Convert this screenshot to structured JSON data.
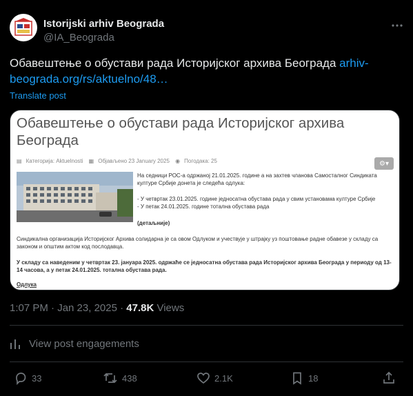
{
  "author": {
    "name": "Istorijski arhiv Beograda",
    "handle": "@IA_Beograda"
  },
  "post": {
    "text": "Обавештење о обустави рада Историјског архива Београда ",
    "link": "arhiv-beograda.org/rs/aktuelno/48…",
    "translate_label": "Translate post"
  },
  "card": {
    "title": "Обавештење о обустави рада Историјског архива Београда",
    "meta_category": "Категорија: Aktuelnosti",
    "meta_published": "Објављено 23 January 2025",
    "meta_views": "Погодака: 25",
    "p1": "На седници РОС-а одржаној 21.01.2025. године а на захтев чланова Самосталног Синдиката културе Србије донета је следећа одлука:",
    "p2a": "- У четвртак 23.01.2025. године једносатна обустава рада у свим установама културе Србије",
    "p2b": "- У петак 24.01.2025. године тотална обустава рада",
    "p3": "(детаљније)",
    "p4": "Синдикална организација Историјског Архива солидарна је са овом Одлуком и учествује у штрајку уз поштовање радне обавезе у складу са законом и општим актом код послодавца.",
    "p5": "У складу са наведеним у четвртак 23. јануара 2025. одржаће се једносатна обустава рада Историјског архива Београда у периоду од 13-14 часова, а у петак 24.01.2025. тотална обустава рада.",
    "p6": "Одлука"
  },
  "timestamp": {
    "time": "1:07 PM · Jan 23, 2025 · ",
    "views_count": "47.8K",
    "views_label": " Views"
  },
  "engagements_label": "View post engagements",
  "actions": {
    "replies": "33",
    "reposts": "438",
    "likes": "2.1K",
    "bookmarks": "18"
  }
}
